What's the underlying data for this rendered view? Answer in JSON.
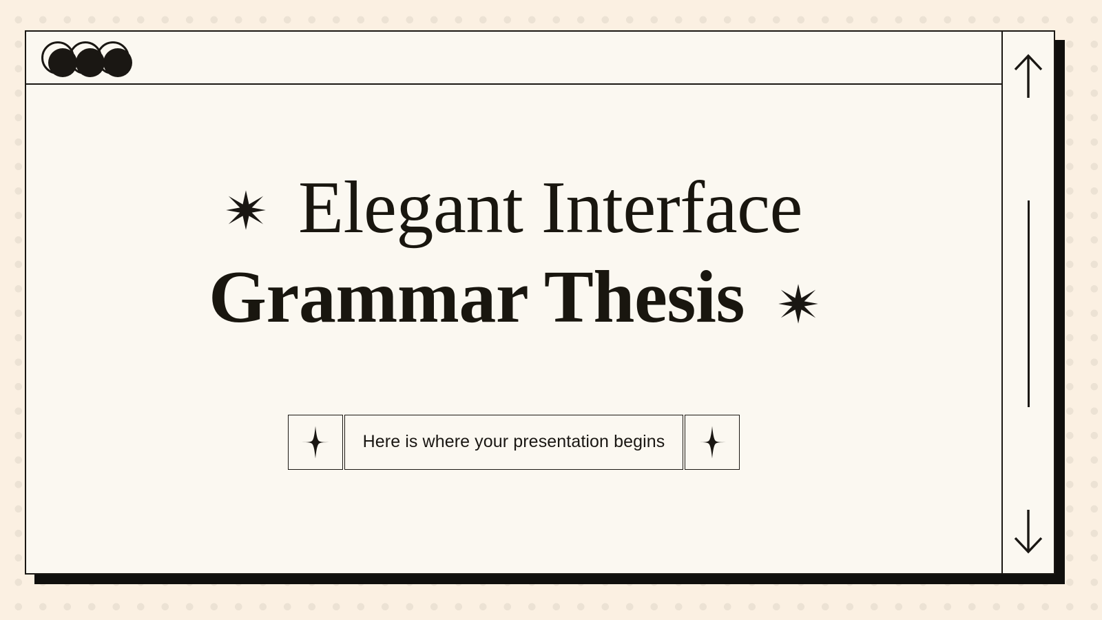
{
  "theme": {
    "page_bg": "#fbf0e2",
    "dot_color": "#ece2d4",
    "window_bg": "#fbf8f1",
    "ink": "#1a1713",
    "shadow": "#100f0d"
  },
  "window": {
    "titlebar": {
      "controls": [
        {
          "name": "window-control-close",
          "icon": "circle-outline-icon"
        },
        {
          "name": "window-control-minimize",
          "icon": "circle-outline-icon"
        },
        {
          "name": "window-control-maximize",
          "icon": "circle-outline-icon"
        }
      ]
    },
    "slide": {
      "title_line_1": "Elegant Interface",
      "title_line_2": "Grammar Thesis",
      "star_left_icon": "six-pointed-star-icon",
      "star_right_icon": "six-pointed-star-icon",
      "subtitle": "Here is where your presentation begins",
      "subtitle_star_left_icon": "four-pointed-sparkle-icon",
      "subtitle_star_right_icon": "four-pointed-sparkle-icon"
    },
    "scrollbar": {
      "up_icon": "arrow-up-icon",
      "down_icon": "arrow-down-icon",
      "thumb": "scrollbar-thumb"
    }
  }
}
